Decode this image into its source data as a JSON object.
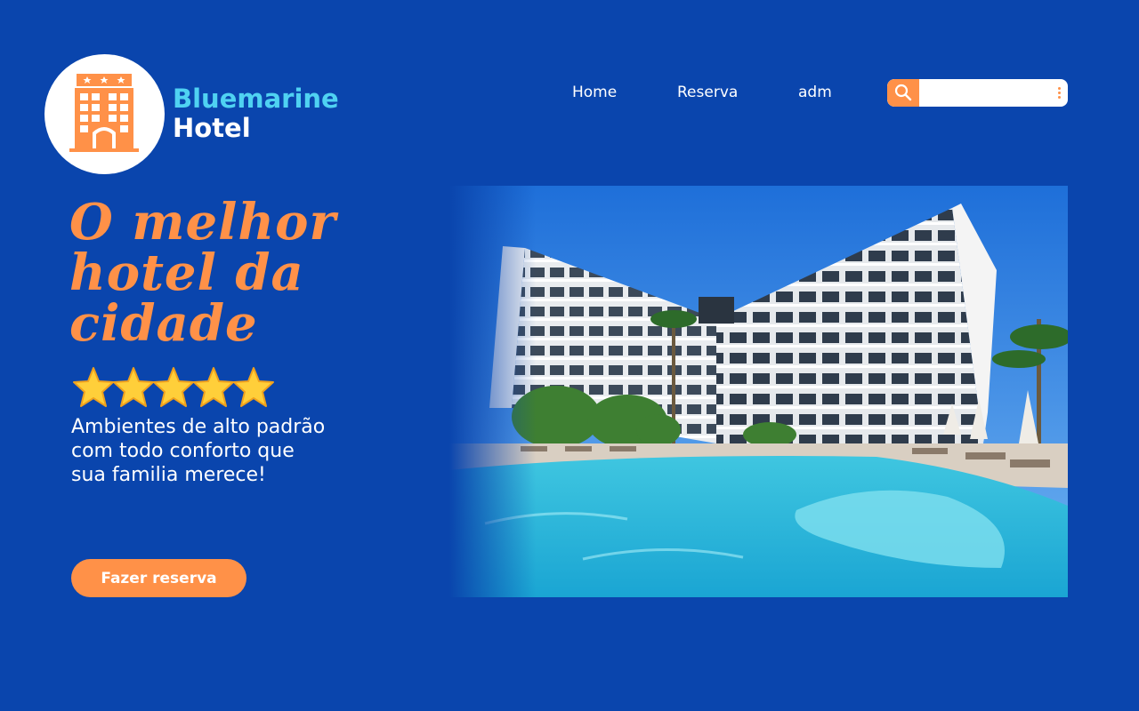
{
  "brand": {
    "line1": "Bluemarine",
    "line2": "Hotel",
    "logo_icon": "hotel-building-icon"
  },
  "nav": {
    "items": [
      {
        "label": "Home"
      },
      {
        "label": "Reserva"
      },
      {
        "label": "adm"
      }
    ]
  },
  "search": {
    "placeholder": "",
    "value": "",
    "icon": "search-icon",
    "menu_icon": "kebab-menu-icon"
  },
  "hero": {
    "headline_line1": "O melhor",
    "headline_line2": "hotel da",
    "headline_line3": "cidade",
    "rating_stars": 5,
    "description_line1": "Ambientes de alto padrão",
    "description_line2": "com todo conforto que",
    "description_line3": "sua familia merece!",
    "cta_label": "Fazer reserva"
  },
  "colors": {
    "background": "#0a45ad",
    "accent": "#ff9148",
    "brand_cyan": "#4fd2f2",
    "text": "#ffffff"
  }
}
